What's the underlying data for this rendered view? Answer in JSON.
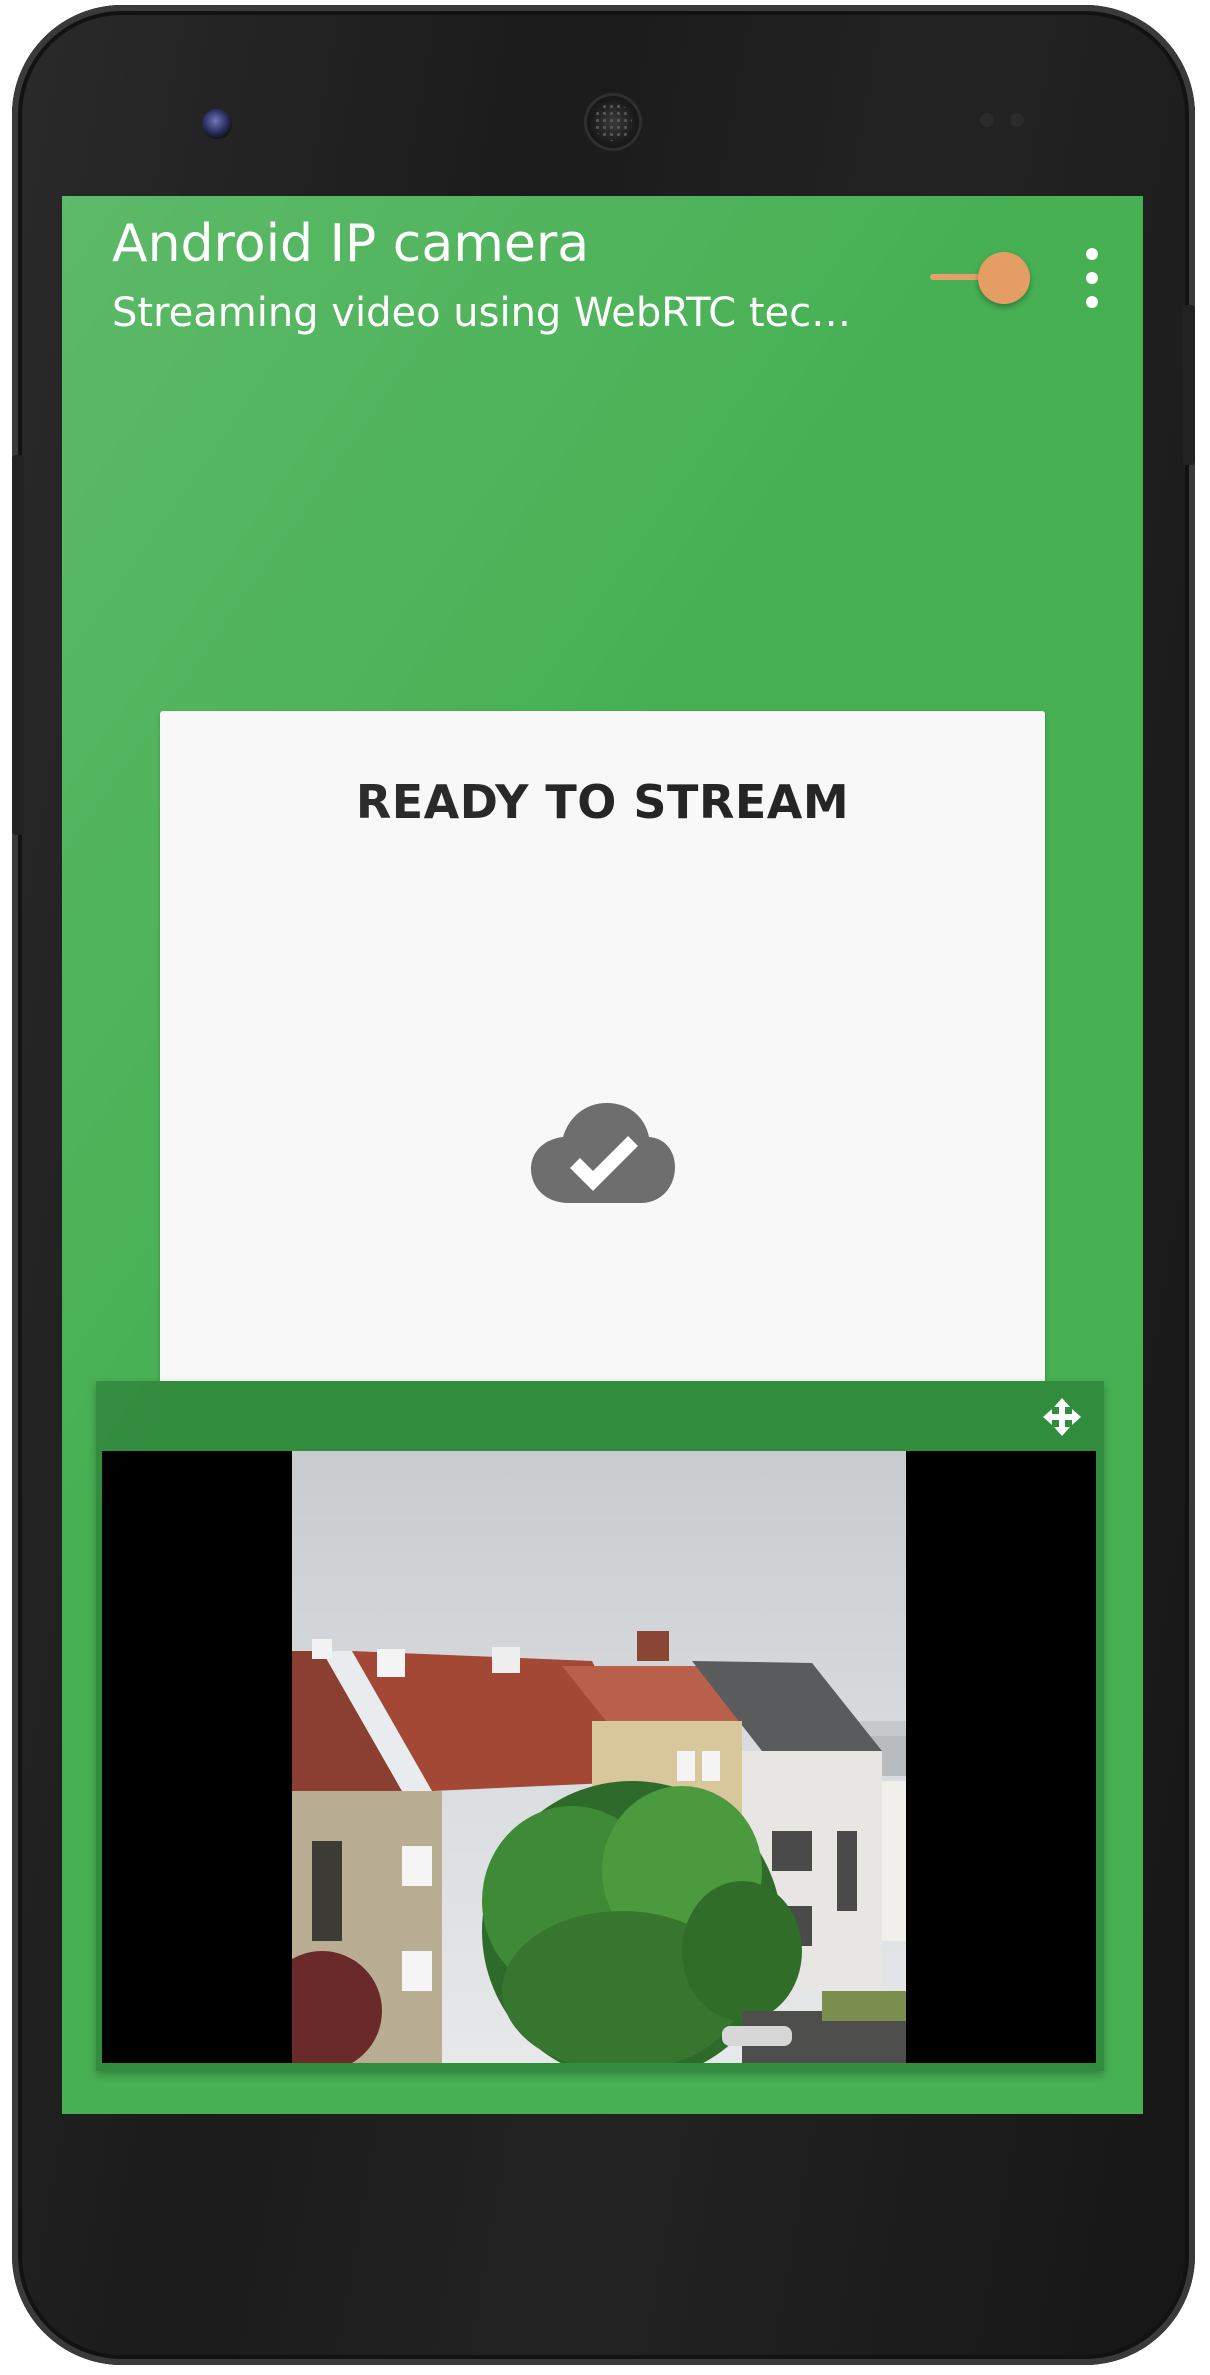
{
  "appbar": {
    "title": "Android IP camera",
    "subtitle": "Streaming video using WebRTC tec…",
    "toggle_state": "on",
    "toggle_color": "#e49d62",
    "menu_icon": "more-vert-icon"
  },
  "status_card": {
    "title": "READY TO STREAM",
    "icon": "cloud-done-icon"
  },
  "preview": {
    "handle_icon": "move-arrows-icon",
    "image": "camera-preview-rooftops-and-tree"
  },
  "colors": {
    "screen_background": "#46b053",
    "preview_header": "#328c3e",
    "card_background": "#f8f8f8",
    "card_title": "#252525",
    "icon_gray": "#6e6e6e"
  }
}
